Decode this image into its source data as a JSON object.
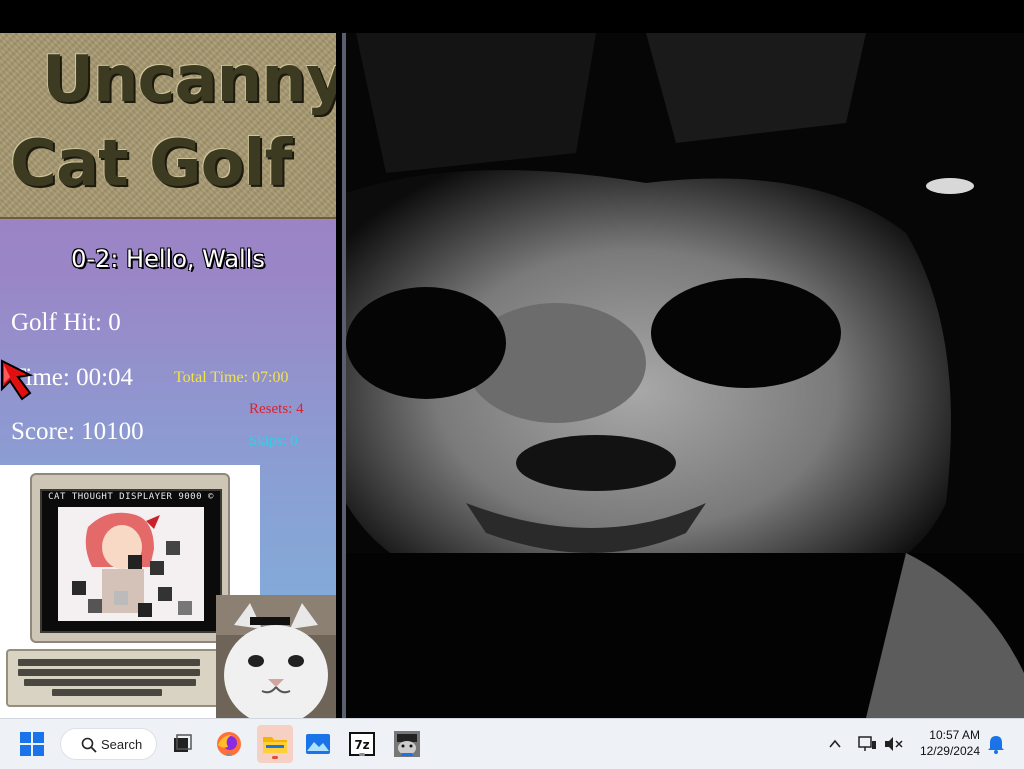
{
  "game": {
    "logo_line1": "Uncanny",
    "logo_line2": "Cat Golf",
    "level_title": "0-2: Hello, Walls",
    "golf_hit": "Golf Hit: 0",
    "time": "Time: 00:04",
    "score": "Score: 10100",
    "total_time": "Total Time: 07:00",
    "resets": "Resets: 4",
    "skips": "Skips: 0",
    "screen_label": "CAT THOUGHT DISPLAYER 9000 ©"
  },
  "taskbar": {
    "search_label": "Search",
    "time": "10:57 AM",
    "date": "12/29/2024",
    "icons": [
      "windows-start-icon",
      "search-icon",
      "task-view-icon",
      "firefox-icon",
      "file-explorer-icon",
      "photos-icon",
      "7zip-icon",
      "cat-app-icon"
    ]
  },
  "colors": {
    "total_time": "#f3e34a",
    "resets": "#e0202a",
    "skips": "#2fd0e8",
    "panel_top": "#a07ec8",
    "panel_bottom": "#7cb5dc"
  }
}
